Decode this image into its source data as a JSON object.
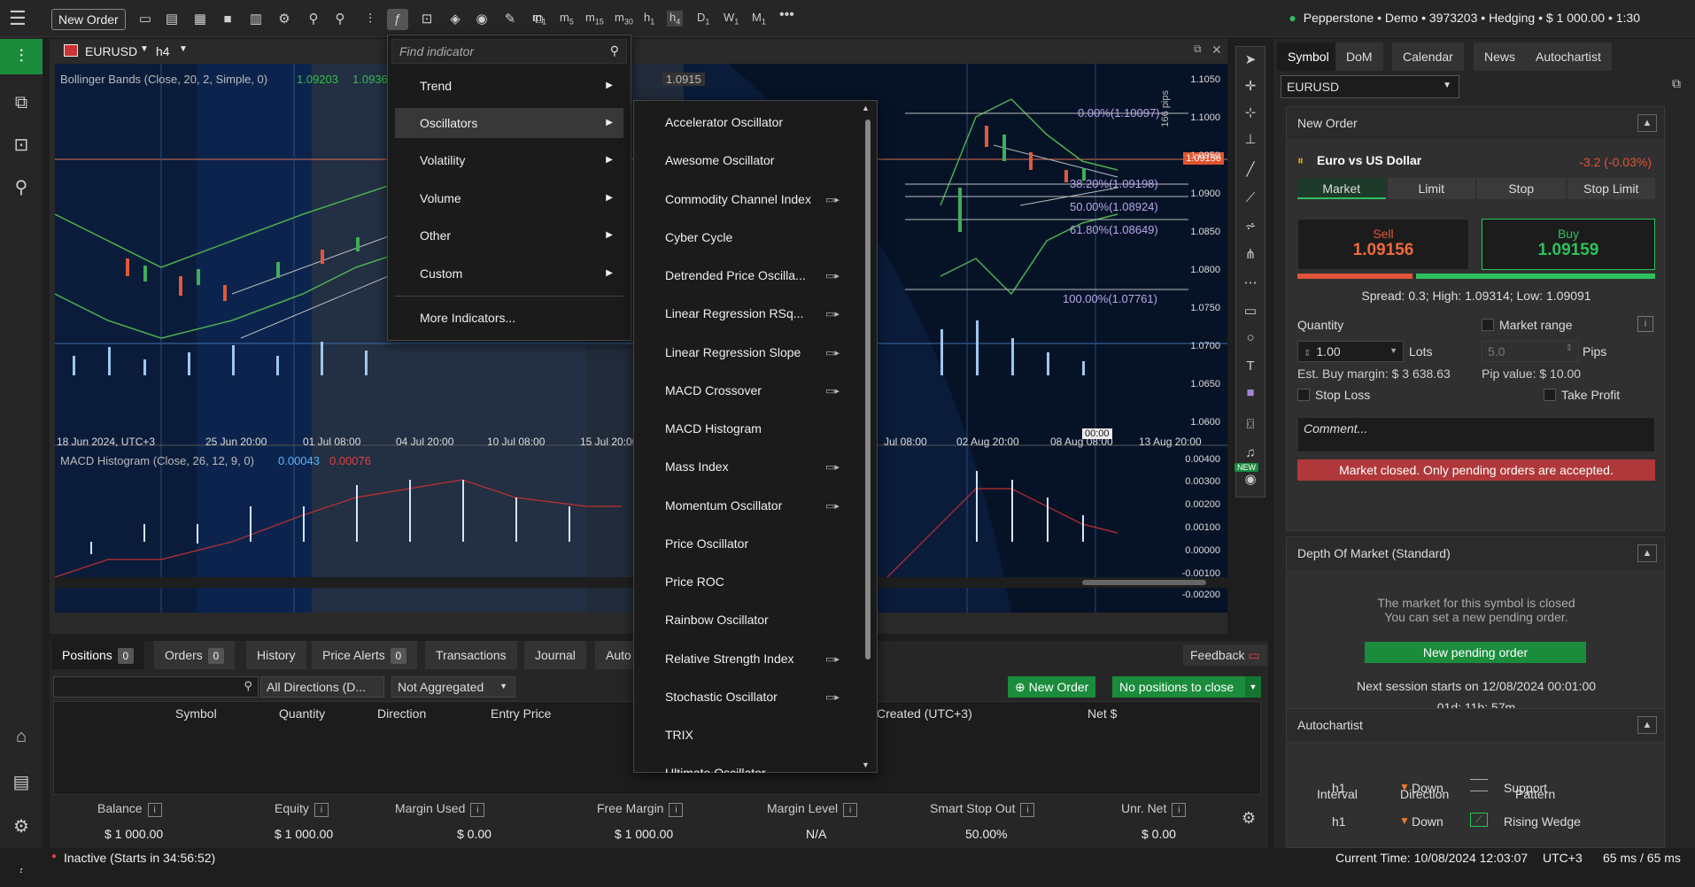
{
  "topbar": {
    "new_order": "New Order",
    "timeframes": [
      "m1",
      "m5",
      "m15",
      "m30",
      "h1",
      "h4",
      "D1",
      "W1",
      "M1"
    ],
    "account": "Pepperstone • Demo • 3973203 • Hedging • $ 1 000.00 • 1:30"
  },
  "chart": {
    "symbol": "EURUSD",
    "timeframe": "h4",
    "indicator_label": "Bollinger Bands (Close, 20, 2, Simple, 0)",
    "bb_values": [
      "1.09203",
      "1.0936"
    ],
    "price_tag": "1.0915",
    "current_price": "1.09156",
    "y_ticks": [
      "1.1050",
      "1.1000",
      "1.0950",
      "1.0900",
      "1.0850",
      "1.0800",
      "1.0750",
      "1.0700",
      "1.0650",
      "1.0600"
    ],
    "x_ticks": [
      "18 Jun 2024, UTC+3",
      "25 Jun 20:00",
      "01 Jul 08:00",
      "04 Jul 20:00",
      "10 Jul 08:00",
      "15 Jul 20:00",
      "Jul 08:00",
      "02 Aug 20:00",
      "08 Aug 08:00",
      "13 Aug 20:00"
    ],
    "fib_levels": [
      "0.00%(1.10097)",
      "38.20%(1.09198)",
      "50.00%(1.08924)",
      "61.80%(1.08649)",
      "100.00%(1.07761)"
    ],
    "pips_label": "166 pips",
    "time_tag": "00:00",
    "macd_label": "MACD Histogram (Close, 26, 12, 9, 0)",
    "macd_values": [
      "0.00043",
      "0.00076"
    ],
    "macd_ticks": [
      "0.00400",
      "0.00300",
      "0.00200",
      "0.00100",
      "0.00000",
      "-0.00100",
      "-0.00200"
    ],
    "new_badge": "NEW"
  },
  "indicator_menu": {
    "placeholder": "Find indicator",
    "items": [
      "Trend",
      "Oscillators",
      "Volatility",
      "Volume",
      "Other",
      "Custom"
    ],
    "more": "More Indicators..."
  },
  "oscillators": [
    "Accelerator Oscillator",
    "Awesome Oscillator",
    "Commodity Channel Index",
    "Cyber Cycle",
    "Detrended Price Oscilla...",
    "Linear Regression RSq...",
    "Linear Regression Slope",
    "MACD Crossover",
    "MACD Histogram",
    "Mass Index",
    "Momentum Oscillator",
    "Price Oscillator",
    "Price ROC",
    "Rainbow Oscillator",
    "Relative Strength Index",
    "Stochastic Oscillator",
    "TRIX",
    "Ultimate Oscillator"
  ],
  "right_panel": {
    "tabs": [
      "Symbol",
      "DoM",
      "Calendar",
      "News",
      "Autochartist"
    ],
    "symbol_select": "EURUSD",
    "new_order": {
      "title": "New Order",
      "symbol_name": "Euro vs US Dollar",
      "change": "-3.2 (-0.03%)",
      "order_tabs": [
        "Market",
        "Limit",
        "Stop",
        "Stop Limit"
      ],
      "sell_label": "Sell",
      "sell_price": "1.09156",
      "buy_label": "Buy",
      "buy_price": "1.09159",
      "spread": "Spread: 0.3; High: 1.09314; Low: 1.09091",
      "quantity_label": "Quantity",
      "market_range": "Market range",
      "quantity": "1.00",
      "lots": "Lots",
      "range_value": "5.0",
      "pips": "Pips",
      "margin": "Est. Buy margin: $ 3 638.63",
      "pip_value": "Pip value: $ 10.00",
      "stop_loss": "Stop Loss",
      "take_profit": "Take Profit",
      "comment_placeholder": "Comment...",
      "warning": "Market closed. Only pending orders are accepted."
    },
    "dom": {
      "title": "Depth Of Market (Standard)",
      "msg1": "The market for this symbol is closed",
      "msg2": "You can set a new pending order.",
      "button": "New pending order",
      "next": "Next session starts on 12/08/2024 00:01:00",
      "countdown": "01d: 11h: 57m"
    },
    "autochartist": {
      "title": "Autochartist",
      "headers": [
        "Interval",
        "Direction",
        "Pattern"
      ],
      "rows": [
        {
          "interval": "h1",
          "direction": "Down",
          "pattern": "Support"
        },
        {
          "interval": "h1",
          "direction": "Down",
          "pattern": "Rising Wedge"
        }
      ]
    }
  },
  "bottom": {
    "tabs": [
      {
        "label": "Positions",
        "count": "0"
      },
      {
        "label": "Orders",
        "count": "0"
      },
      {
        "label": "History"
      },
      {
        "label": "Price Alerts",
        "count": "0"
      },
      {
        "label": "Transactions"
      },
      {
        "label": "Journal"
      },
      {
        "label": "Auto"
      }
    ],
    "feedback": "Feedback",
    "directions": "All Directions (D...",
    "aggregation": "Not Aggregated",
    "new_order": "New Order",
    "no_positions": "No positions to close",
    "columns": [
      "Symbol",
      "Quantity",
      "Direction",
      "Entry Price",
      "Created (UTC+3)",
      "Net $"
    ],
    "summary": [
      {
        "label": "Balance",
        "value": "$ 1 000.00"
      },
      {
        "label": "Equity",
        "value": "$ 1 000.00"
      },
      {
        "label": "Margin Used",
        "value": "$ 0.00"
      },
      {
        "label": "Free Margin",
        "value": "$ 1 000.00"
      },
      {
        "label": "Margin Level",
        "value": "N/A"
      },
      {
        "label": "Smart Stop Out",
        "value": "50.00%"
      },
      {
        "label": "Unr. Net",
        "value": "$ 0.00"
      }
    ]
  },
  "status": {
    "left": "Inactive (Starts in 34:56:52)",
    "time": "Current Time:  10/08/2024 12:03:07",
    "tz": "UTC+3",
    "latency": "65 ms / 65 ms"
  }
}
